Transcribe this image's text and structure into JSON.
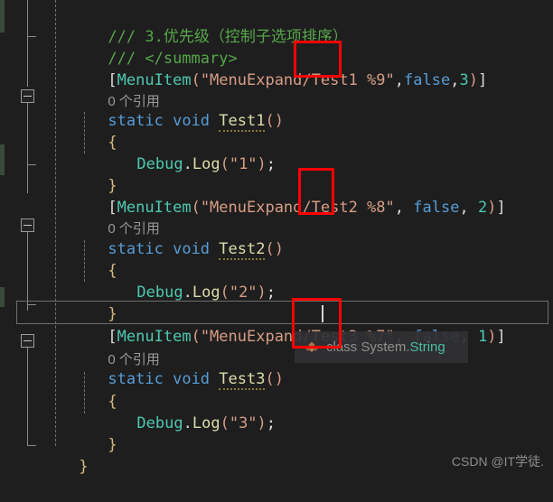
{
  "editor": {
    "background": "#1e1e1e",
    "lines": [
      {
        "indent": 1,
        "type": "comment",
        "text": "/// 3.优先级（控制子选项排序）"
      },
      {
        "indent": 1,
        "type": "comment",
        "text": "/// </summary>"
      },
      {
        "indent": 1,
        "type": "attribute",
        "text": "[MenuItem(\"MenuExpand/Test1 %9\", false, 3)]"
      },
      {
        "indent": 1,
        "type": "codelens",
        "text": "0 个引用"
      },
      {
        "indent": 1,
        "type": "signature",
        "text": "static void Test1()"
      },
      {
        "indent": 1,
        "type": "brace",
        "text": "{"
      },
      {
        "indent": 2,
        "type": "statement",
        "text": "Debug.Log(\"1\");"
      },
      {
        "indent": 1,
        "type": "brace",
        "text": "}"
      },
      {
        "indent": 1,
        "type": "attribute",
        "text": "[MenuItem(\"MenuExpand/Test2 %8\", false, 2)]"
      },
      {
        "indent": 1,
        "type": "codelens",
        "text": "0 个引用"
      },
      {
        "indent": 1,
        "type": "signature",
        "text": "static void Test2()"
      },
      {
        "indent": 1,
        "type": "brace",
        "text": "{"
      },
      {
        "indent": 2,
        "type": "statement",
        "text": "Debug.Log(\"2\");"
      },
      {
        "indent": 1,
        "type": "brace",
        "text": "}"
      },
      {
        "indent": 1,
        "type": "attribute",
        "text": "[MenuItem(\"MenuExpand/Test3 %7\", false, 1)]"
      },
      {
        "indent": 1,
        "type": "codelens",
        "text": "0 个引用"
      },
      {
        "indent": 1,
        "type": "signature",
        "text": "static void Test3()"
      },
      {
        "indent": 1,
        "type": "brace",
        "text": "{"
      },
      {
        "indent": 2,
        "type": "statement",
        "text": "Debug.Log(\"3\");"
      },
      {
        "indent": 1,
        "type": "brace",
        "text": "}"
      },
      {
        "indent": 0,
        "type": "brace",
        "text": "}"
      }
    ],
    "tokens": {
      "comment_1": "/// 3.优先级（控制子选项排序）",
      "comment_2": "/// </summary>",
      "attr_open": "[",
      "attr_name": "MenuItem",
      "paren_open": "(",
      "paren_close": ")",
      "attr_close": "]",
      "codelens_label": "0 个引用",
      "kw_static": "static",
      "kw_void": "void",
      "kw_false": "false",
      "type_debug": "Debug",
      "method_log": "Log",
      "dot": ".",
      "semicolon": ";",
      "comma": ",",
      "brace_open": "{",
      "brace_close": "}",
      "method_test1": "Test1",
      "method_test2": "Test2",
      "method_test3": "Test3",
      "str_menu1": "\"MenuExpand/Test1 %9\"",
      "str_menu2": "\"MenuExpand/Test2 %8\"",
      "str_menu3": "\"MenuExpand/Test3 %7\"",
      "str_one": "\"1\"",
      "str_two": "\"2\"",
      "str_three": "\"3\"",
      "num_3": "3",
      "num_2": "2",
      "num_1": "1"
    },
    "colors": {
      "comment": "#57a64a",
      "keyword": "#569cd6",
      "type": "#4ec9b0",
      "method": "#dcdcaa",
      "string": "#d69d85",
      "plain": "#dcdcdc",
      "brace": "#d7ba7d",
      "codelens": "#9a9a9a",
      "annotation_box": "#fe0000",
      "active_line_border": "#6e6e6e"
    }
  },
  "annotations": {
    "boxes": [
      {
        "label": "hotkey-%9",
        "value": "%9\","
      },
      {
        "label": "hotkey-%8",
        "value": "%8\","
      },
      {
        "label": "hotkey-%7",
        "value": "%7\""
      }
    ]
  },
  "tooltip": {
    "icon": "class-icon",
    "keyword": "class ",
    "namespace": "System.",
    "classname": "String",
    "full_text": "class System.String"
  },
  "watermark": {
    "text": "CSDN @IT学徒."
  },
  "fold_margin": {
    "fold_boxes": [
      {
        "name": "fold-toggle-test1"
      },
      {
        "name": "fold-toggle-test2"
      },
      {
        "name": "fold-toggle-test3"
      }
    ]
  }
}
